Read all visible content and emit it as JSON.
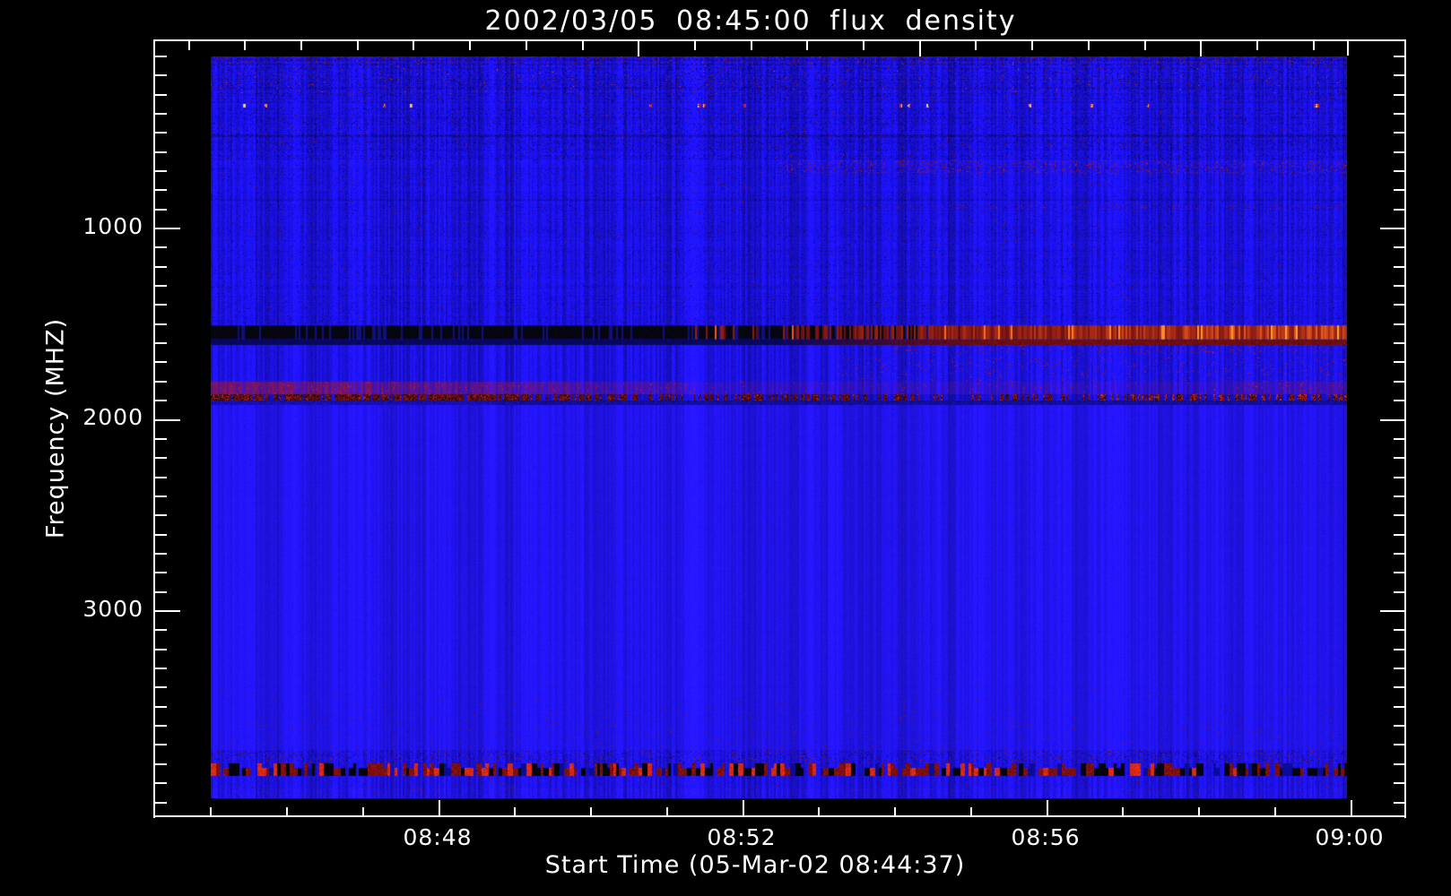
{
  "title": "2002/03/05 08:45:00 flux density",
  "chart_data": {
    "type": "heatmap",
    "subtype": "radio-spectrogram",
    "title": "2002/03/05 08:45:00 flux density",
    "xlabel": "Start Time (05-Mar-02 08:44:37)",
    "ylabel": "Frequency (MHZ)",
    "x_axis": {
      "major_tick_labels": [
        "08:48",
        "08:52",
        "08:56",
        "09:00"
      ],
      "minor_tick_interval_sec": 60,
      "start_time": "05-Mar-02 08:44:37"
    },
    "y_axis": {
      "major_tick_labels": [
        "1000",
        "2000",
        "3000"
      ],
      "minor_tick_interval_mhz": 100,
      "increases": "downward"
    },
    "image_extent": {
      "freq_mhz": [
        105,
        3983
      ],
      "time": [
        "08:45:01",
        "09:00:00"
      ]
    },
    "colormap": "blue (low flux) to red/white (high flux)",
    "colors": {
      "background": "#000000",
      "base_blue": "#1a10e4",
      "quiet_blue": "#2214f0",
      "text": "#ffffff",
      "axis": "#ffffff"
    },
    "legend": "none",
    "grid": false,
    "features": [
      {
        "name": "top-noise-band",
        "freq_mhz": [
          105,
          300
        ],
        "appearance": "granular blue noise with dark and red speckles"
      },
      {
        "name": "bright-dot-row",
        "freq_mhz": [
          349,
          372
        ],
        "appearance": "sparse bright dots (white, yellow, orange, red)"
      },
      {
        "name": "right-side-red-smears",
        "freq_mhz": [
          650,
          720
        ],
        "appearance": "faint red speckle rows, mostly right half"
      },
      {
        "name": "interference-band",
        "freq_mhz": [
          1511,
          1586
        ],
        "appearance": "striped band: black before ~08:52, turning bright red-orange toward 09:00",
        "colors": [
          "#050510",
          "#cc2200",
          "#ff8833"
        ]
      },
      {
        "name": "interference-band-lower-edge",
        "freq_mhz": [
          1586,
          1614
        ],
        "appearance": "thin dark line: navy at left, dark red at right",
        "colors": [
          "#080858",
          "#6e0e0c"
        ]
      },
      {
        "name": "purple-band",
        "freq_mhz": [
          1806,
          1871
        ],
        "appearance": "maroon-purple striped band, strongest at left, fading rightward",
        "colors": [
          "#7d1560"
        ]
      },
      {
        "name": "red-speckle-line",
        "freq_mhz": [
          1871,
          1904
        ],
        "appearance": "dense dark-red speckled line, brighter sparse dashes at right",
        "colors": [
          "#821212",
          "#d72d16"
        ]
      },
      {
        "name": "navy-line",
        "freq_mhz": [
          1904,
          1927
        ],
        "appearance": "thin dark navy line",
        "colors": [
          "#0c0a78"
        ]
      },
      {
        "name": "quiet-region",
        "freq_mhz": [
          1927,
          3730
        ],
        "appearance": "smooth bright blue with faint vertical striping"
      },
      {
        "name": "bottom-speckle-band",
        "freq_mhz": [
          3800,
          3866
        ],
        "appearance": "alternating black / dark-red / bright-red segments across full width",
        "colors": [
          "#04040c",
          "#78100c",
          "#d22812"
        ]
      },
      {
        "name": "bottom-edge-noise",
        "freq_mhz": [
          3866,
          3983
        ],
        "appearance": "blue noise with violet-tinged striping at the bottom edge"
      }
    ]
  }
}
